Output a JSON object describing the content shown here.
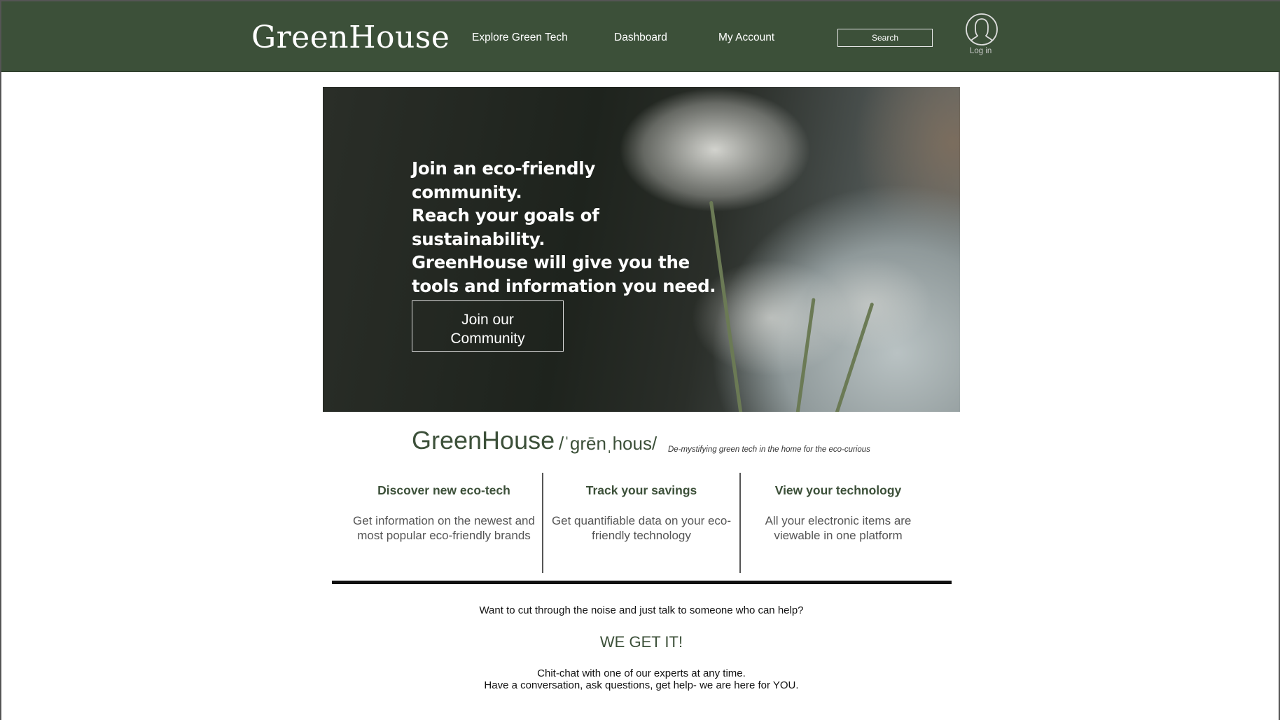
{
  "header": {
    "logo": "GreenHouse",
    "nav": [
      "Explore Green Tech",
      "Dashboard",
      "My Account"
    ],
    "search_label": "Search",
    "login_label": "Log in"
  },
  "hero": {
    "lines": [
      "Join an eco-friendly",
      "community.",
      "Reach your goals of",
      "sustainability.",
      "GreenHouse will give you the",
      "tools and information you need."
    ],
    "button_line1": "Join our",
    "button_line2": "Community"
  },
  "definition": {
    "title": "GreenHouse",
    "pronunciation": "/ˈgrēnˌhous/",
    "tagline": "De-mystifying green tech in the home for the eco-curious"
  },
  "features": [
    {
      "title": "Discover new eco-tech",
      "body": "Get information on the newest and most popular eco-friendly brands"
    },
    {
      "title": "Track your savings",
      "body": "Get quantifiable data on your eco-friendly technology"
    },
    {
      "title": "View your technology",
      "body": "All your electronic items are viewable in one platform"
    }
  ],
  "contact": {
    "question": "Want to cut through the noise and just talk to someone who can help?",
    "headline": "WE GET IT!",
    "line1": "Chit-chat with one of our experts at any time.",
    "line2": "Have a conversation, ask questions, get help- we are here for YOU."
  },
  "colors": {
    "brand": "#3c5039"
  }
}
